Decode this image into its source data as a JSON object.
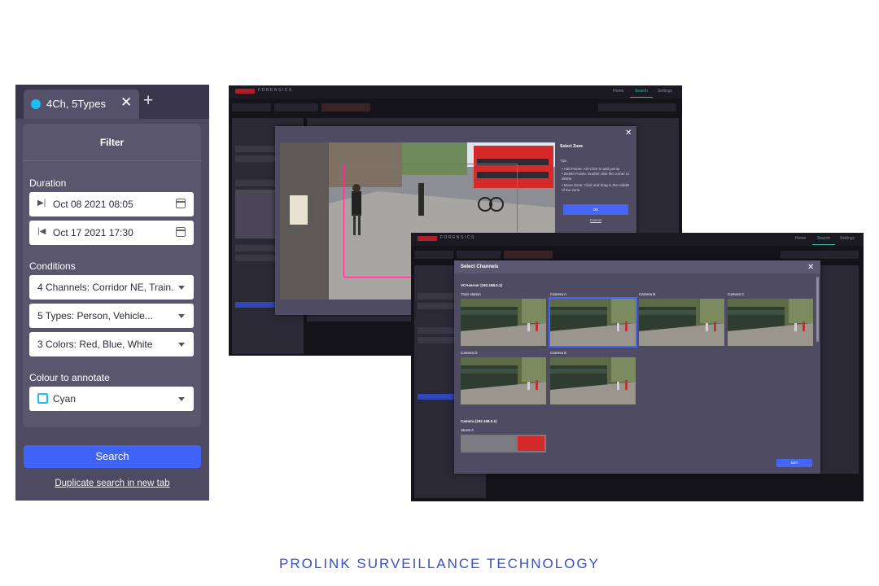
{
  "filter_panel": {
    "tab": {
      "label": "4Ch, 5Types",
      "dot_color": "#1fbdf2"
    },
    "title": "Filter",
    "duration": {
      "label": "Duration",
      "start": "Oct 08 2021 08:05",
      "end": "Oct 17 2021 17:30"
    },
    "conditions": {
      "label": "Conditions",
      "channels": "4 Channels: Corridor NE, Train...",
      "types": "5 Types: Person, Vehicle...",
      "colors": "3 Colors: Red, Blue, White"
    },
    "annotate": {
      "label": "Colour to annotate",
      "value": "Cyan"
    },
    "search_button": "Search",
    "duplicate_link": "Duplicate search in new tab"
  },
  "shot1": {
    "brand": "FORENSICS",
    "nav": [
      "Home",
      "Search",
      "Settings"
    ],
    "zone_dialog": {
      "title": "Select Zone",
      "tips_label": "Tips",
      "tips": [
        "• Add Points: Alt+Click to add points",
        "• Delete Points: Double click the corner to delete",
        "• Move Zone: Click and drag in the middle of the zone"
      ],
      "ok": "OK",
      "cancel": "Cancel"
    }
  },
  "shot2": {
    "brand": "FORENSICS",
    "nav": [
      "Home",
      "Search",
      "Settings"
    ],
    "channels_dialog": {
      "title": "Select Channels",
      "group1": "VCAserver (192.168.0.1)",
      "cameras": [
        "Train station",
        "Camera A",
        "Camera B",
        "Camera C",
        "Camera D",
        "Camera E"
      ],
      "group2": "Camera (192.168.0.1)",
      "street_label": "Street A",
      "set_button": "SET"
    }
  },
  "caption": "PROLINK SURVEILLANCE TECHNOLOGY",
  "colors": {
    "accent": "#3f63f7",
    "panel": "#4e4a61",
    "zone": "#ff2b8c",
    "caption": "#3a4fc4"
  }
}
